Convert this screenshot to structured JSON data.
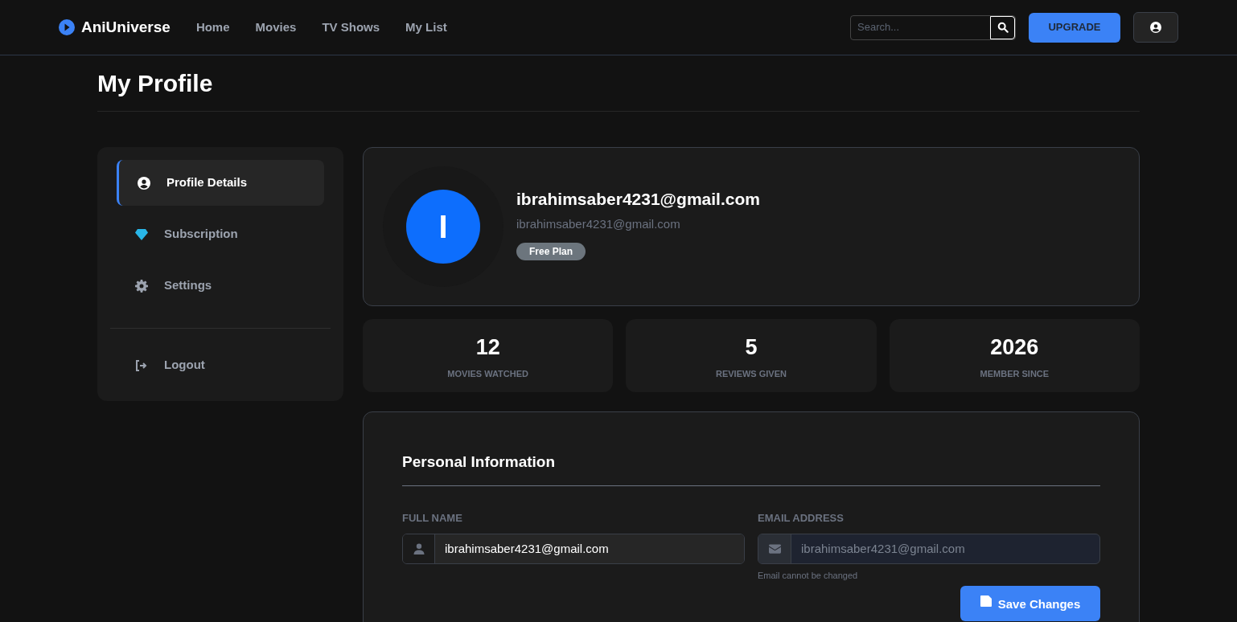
{
  "nav": {
    "brand": "AniUniverse",
    "links": [
      {
        "label": "Home"
      },
      {
        "label": "Movies"
      },
      {
        "label": "TV Shows"
      },
      {
        "label": "My List"
      }
    ],
    "search": {
      "placeholder": "Search..."
    },
    "upgrade": "UPGRADE"
  },
  "page_title": "My Profile",
  "sidebar": {
    "items": [
      {
        "kind": "profile",
        "label": "Profile Details",
        "selected": true
      },
      {
        "kind": "subscription",
        "label": "Subscription",
        "selected": false
      },
      {
        "kind": "settings",
        "label": "Settings",
        "selected": false
      },
      {
        "kind": "logout",
        "label": "Logout",
        "selected": false
      }
    ]
  },
  "profile": {
    "initial": "I",
    "name": "ibrahimsaber4231@gmail.com",
    "email": "ibrahimsaber4231@gmail.com",
    "plan": "Free Plan"
  },
  "stats": [
    {
      "value": "12",
      "label": "MOVIES WATCHED"
    },
    {
      "value": "5",
      "label": "REVIEWS GIVEN"
    },
    {
      "value": "2026",
      "label": "MEMBER SINCE"
    }
  ],
  "personal": {
    "title": "Personal Information",
    "full_name": {
      "label": "FULL NAME",
      "value": "ibrahimsaber4231@gmail.com"
    },
    "email": {
      "label": "EMAIL ADDRESS",
      "value": "ibrahimsaber4231@gmail.com",
      "disabled": true,
      "hint": "Email cannot be changed"
    },
    "save": "Save Changes"
  }
}
